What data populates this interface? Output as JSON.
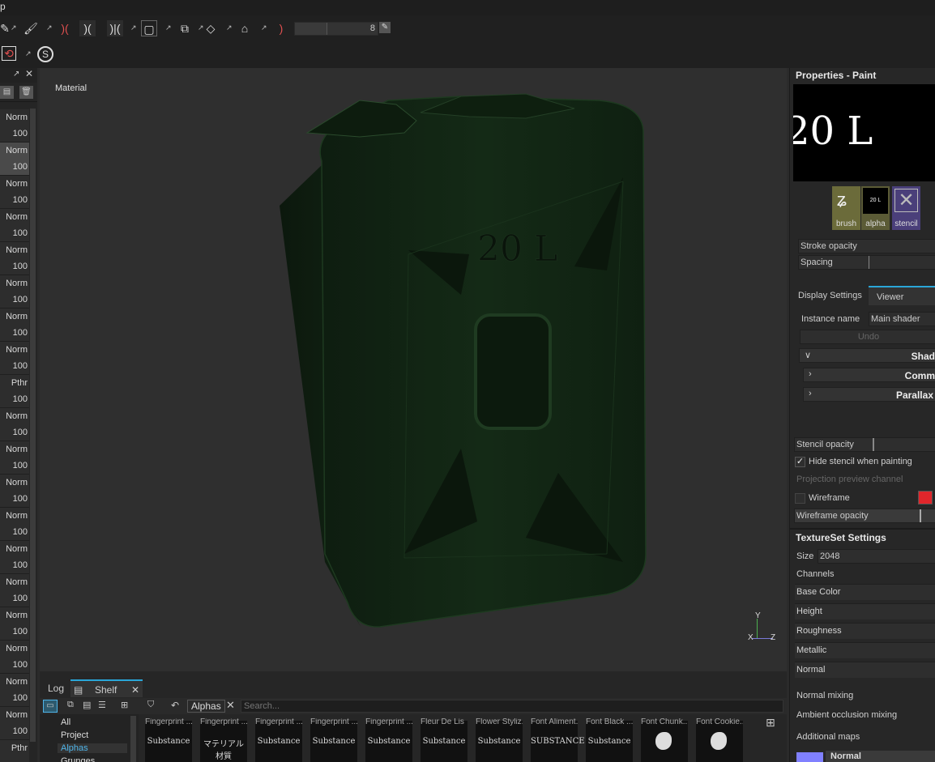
{
  "menubar": {
    "label": "p"
  },
  "toolbar": {
    "brush_size_value": "8"
  },
  "layers": {
    "rows": [
      {
        "mode": "Norm",
        "opacity": "100",
        "selected": false
      },
      {
        "mode": "Norm",
        "opacity": "100",
        "selected": true
      },
      {
        "mode": "Norm",
        "opacity": "100",
        "selected": false
      },
      {
        "mode": "Norm",
        "opacity": "100",
        "selected": false
      },
      {
        "mode": "Norm",
        "opacity": "100",
        "selected": false
      },
      {
        "mode": "Norm",
        "opacity": "100",
        "selected": false
      },
      {
        "mode": "Norm",
        "opacity": "100",
        "selected": false
      },
      {
        "mode": "Norm",
        "opacity": "100",
        "selected": false
      },
      {
        "mode": "Pthr",
        "opacity": "100",
        "selected": false
      },
      {
        "mode": "Norm",
        "opacity": "100",
        "selected": false
      },
      {
        "mode": "Norm",
        "opacity": "100",
        "selected": false
      },
      {
        "mode": "Norm",
        "opacity": "100",
        "selected": false
      },
      {
        "mode": "Norm",
        "opacity": "100",
        "selected": false
      },
      {
        "mode": "Norm",
        "opacity": "100",
        "selected": false
      },
      {
        "mode": "Norm",
        "opacity": "100",
        "selected": false
      },
      {
        "mode": "Norm",
        "opacity": "100",
        "selected": false
      },
      {
        "mode": "Norm",
        "opacity": "100",
        "selected": false
      },
      {
        "mode": "Norm",
        "opacity": "100",
        "selected": false
      },
      {
        "mode": "Norm",
        "opacity": "100",
        "selected": false
      },
      {
        "mode": "Pthr",
        "opacity": "",
        "selected": false
      }
    ]
  },
  "viewport": {
    "title": "Material",
    "can_label": "20 L",
    "axis_y": "Y",
    "axis_x": "X",
    "axis_z": "Z"
  },
  "bottom": {
    "tabs": {
      "log": "Log",
      "shelf": "Shelf"
    },
    "filter_tag": "Alphas",
    "search_placeholder": "Search...",
    "categories": [
      "All",
      "Project",
      "Alphas",
      "Grunges"
    ],
    "selected_category": "Alphas",
    "thumbnails": [
      {
        "caption": "Fingerprint ...",
        "text": "Substance"
      },
      {
        "caption": "Fingerprint ...",
        "text": "マテリアル 材質"
      },
      {
        "caption": "Fingerprint ...",
        "text": "Substance"
      },
      {
        "caption": "Fingerprint ...",
        "text": "Substance"
      },
      {
        "caption": "Fingerprint ...",
        "text": "Substance"
      },
      {
        "caption": "Fleur De Lis",
        "text": "Substance"
      },
      {
        "caption": "Flower Styliz...",
        "text": "Substance"
      },
      {
        "caption": "Font Aliment...",
        "text": "SUBSTANCE"
      },
      {
        "caption": "Font Black ...",
        "text": "Substance"
      },
      {
        "caption": "Font Chunk...",
        "text": ""
      },
      {
        "caption": "Font Cookie...",
        "text": ""
      }
    ]
  },
  "properties": {
    "title": "Properties - Paint",
    "preview_text": "20 L",
    "slots": {
      "brush": "brush",
      "alpha": "alpha",
      "stencil": "stencil"
    },
    "alpha_thumb_text": "20 L",
    "stroke_opacity": "Stroke opacity",
    "spacing": "Spacing",
    "tabs": {
      "display": "Display Settings",
      "viewer": "Viewer Settings"
    },
    "instance_name_label": "Instance name",
    "instance_name_value": "Main shader",
    "undo": "Undo",
    "sections": [
      "Shad",
      "Comm",
      "Parallax"
    ],
    "stencil_opacity": "Stencil opacity",
    "hide_stencil": "Hide stencil when painting",
    "projection_preview": "Projection preview channel",
    "wireframe": "Wireframe",
    "wireframe_color": "#e0262b",
    "wireframe_opacity": "Wireframe opacity"
  },
  "textureset": {
    "title": "TextureSet Settings",
    "size_label": "Size",
    "size_value": "2048",
    "channels_label": "Channels",
    "channels": [
      "Base Color",
      "Height",
      "Roughness",
      "Metallic",
      "Normal"
    ],
    "normal_mixing": "Normal mixing",
    "ao_mixing": "Ambient occlusion mixing",
    "additional_maps": "Additional maps",
    "normal_map": "Normal"
  }
}
